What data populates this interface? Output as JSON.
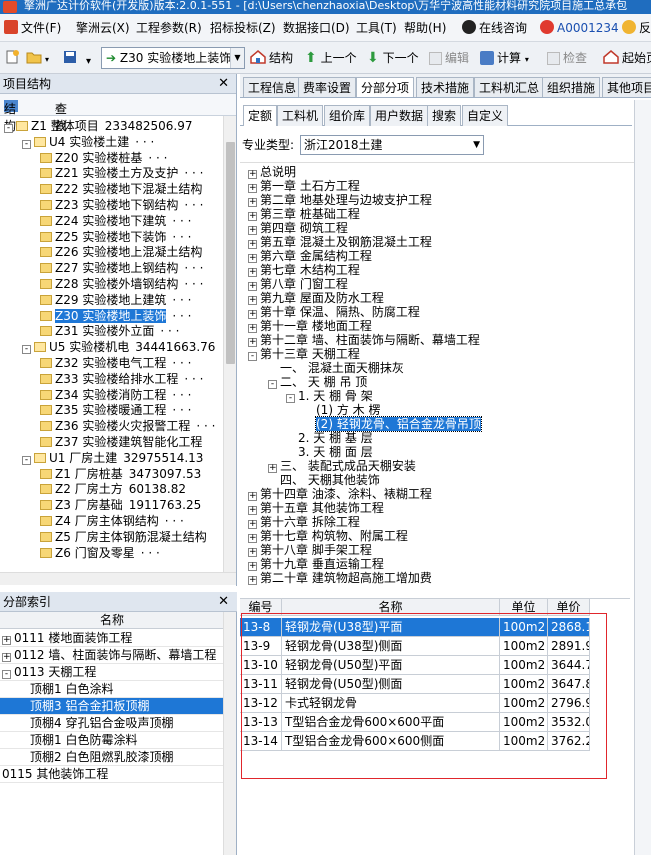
{
  "window": {
    "title": "擎洲广达计价软件(开发版)版本:2.0.1-551 - [d:\\Users\\chenzhaoxia\\Desktop\\万华宁波高性能材料研究院项目施工总承包"
  },
  "menu": {
    "items": [
      "文件(F)",
      "擎洲云(X)",
      "工程参数(R)",
      "招标投标(Z)",
      "数据接口(D)",
      "工具(T)",
      "帮助(H)"
    ],
    "online": "在线咨询",
    "user": "A0001234",
    "extra": "反"
  },
  "toolbar": {
    "current_node": "Z30 实验楼地上装饰",
    "structure": "结构",
    "prev": "上一个",
    "next": "下一个",
    "edit": "编辑",
    "calc": "计算",
    "check": "检查",
    "start": "起始页"
  },
  "project_panel": {
    "title": "项目结构",
    "tool_structure": "结构",
    "tool_find": "查找",
    "tree": [
      {
        "code": "Z1",
        "name": "整体项目",
        "value": "233482506.97",
        "level": 0,
        "expander": "-"
      },
      {
        "code": "U4",
        "name": "实验楼土建",
        "value": "· · ·",
        "level": 1,
        "expander": "-"
      },
      {
        "code": "Z20",
        "name": "实验楼桩基",
        "value": "· · ·",
        "level": 2
      },
      {
        "code": "Z21",
        "name": "实验楼土方及支护",
        "value": "· · ·",
        "level": 2
      },
      {
        "code": "Z22",
        "name": "实验楼地下混凝土结构",
        "value": "",
        "level": 2
      },
      {
        "code": "Z23",
        "name": "实验楼地下钢结构",
        "value": "· · ·",
        "level": 2
      },
      {
        "code": "Z24",
        "name": "实验楼地下建筑",
        "value": "· · ·",
        "level": 2
      },
      {
        "code": "Z25",
        "name": "实验楼地下装饰",
        "value": "· · ·",
        "level": 2
      },
      {
        "code": "Z26",
        "name": "实验楼地上混凝土结构",
        "value": "",
        "level": 2
      },
      {
        "code": "Z27",
        "name": "实验楼地上钢结构",
        "value": "· · ·",
        "level": 2
      },
      {
        "code": "Z28",
        "name": "实验楼外墙钢结构",
        "value": "· · ·",
        "level": 2
      },
      {
        "code": "Z29",
        "name": "实验楼地上建筑",
        "value": "· · ·",
        "level": 2
      },
      {
        "code": "Z30",
        "name": "实验楼地上装饰",
        "value": "· · ·",
        "level": 2,
        "selected": true
      },
      {
        "code": "Z31",
        "name": "实验楼外立面",
        "value": "· · ·",
        "level": 2
      },
      {
        "code": "U5",
        "name": "实验楼机电",
        "value": "34441663.76",
        "level": 1,
        "expander": "-"
      },
      {
        "code": "Z32",
        "name": "实验楼电气工程",
        "value": "· · ·",
        "level": 2
      },
      {
        "code": "Z33",
        "name": "实验楼给排水工程",
        "value": "· · ·",
        "level": 2
      },
      {
        "code": "Z34",
        "name": "实验楼消防工程",
        "value": "· · ·",
        "level": 2
      },
      {
        "code": "Z35",
        "name": "实验楼暖通工程",
        "value": "· · ·",
        "level": 2
      },
      {
        "code": "Z36",
        "name": "实验楼火灾报警工程",
        "value": "· · ·",
        "level": 2
      },
      {
        "code": "Z37",
        "name": "实验楼建筑智能化工程",
        "value": "",
        "level": 2
      },
      {
        "code": "U1",
        "name": "厂房土建",
        "value": "32975514.13",
        "level": 1,
        "expander": "-"
      },
      {
        "code": "Z1",
        "name": "厂房桩基",
        "value": "3473097.53",
        "level": 2
      },
      {
        "code": "Z2",
        "name": "厂房土方",
        "value": "60138.82",
        "level": 2
      },
      {
        "code": "Z3",
        "name": "厂房基础",
        "value": "1911763.25",
        "level": 2
      },
      {
        "code": "Z4",
        "name": "厂房主体钢结构",
        "value": "· · ·",
        "level": 2
      },
      {
        "code": "Z5",
        "name": "厂房主体钢筋混凝土结构",
        "value": "",
        "level": 2
      },
      {
        "code": "Z6",
        "name": "门窗及零星",
        "value": "· · ·",
        "level": 2
      }
    ]
  },
  "index_panel": {
    "title": "分部索引",
    "header": "名称",
    "rows": [
      {
        "text": "0111 楼地面装饰工程",
        "level": 0,
        "expander": "+"
      },
      {
        "text": "0112 墙、柱面装饰与隔断、幕墙工程",
        "level": 0,
        "expander": "+"
      },
      {
        "text": "0113 天棚工程",
        "level": 0,
        "expander": "-"
      },
      {
        "text": "顶棚1 白色涂料",
        "level": 1
      },
      {
        "text": "顶棚3 铝合金扣板顶棚",
        "level": 1,
        "selected": true
      },
      {
        "text": "顶棚4 穿孔铝合金吸声顶棚",
        "level": 1
      },
      {
        "text": "顶棚1 白色防霉涂料",
        "level": 1
      },
      {
        "text": "顶棚2 白色阻燃乳胶漆顶棚",
        "level": 1
      },
      {
        "text": "0115 其他装饰工程",
        "level": 0
      }
    ]
  },
  "main_tabs": [
    "工程信息",
    "费率设置",
    "分部分项",
    "技术措施",
    "工料机汇总",
    "组织措施",
    "其他项目"
  ],
  "main_tabs_active": 2,
  "sub_tabs": [
    "定额",
    "工料机",
    "组价库",
    "用户数据",
    "搜索",
    "自定义"
  ],
  "sub_tabs_active": 0,
  "spec_label": "专业类型:",
  "spec_value": "浙江2018土建",
  "chapters": [
    {
      "text": "总说明",
      "level": 0,
      "expander": "+"
    },
    {
      "text": "第一章 土石方工程",
      "level": 0,
      "expander": "+"
    },
    {
      "text": "第二章 地基处理与边坡支护工程",
      "level": 0,
      "expander": "+"
    },
    {
      "text": "第三章 桩基础工程",
      "level": 0,
      "expander": "+"
    },
    {
      "text": "第四章 砌筑工程",
      "level": 0,
      "expander": "+"
    },
    {
      "text": "第五章 混凝土及钢筋混凝土工程",
      "level": 0,
      "expander": "+"
    },
    {
      "text": "第六章 金属结构工程",
      "level": 0,
      "expander": "+"
    },
    {
      "text": "第七章 木结构工程",
      "level": 0,
      "expander": "+"
    },
    {
      "text": "第八章 门窗工程",
      "level": 0,
      "expander": "+"
    },
    {
      "text": "第九章 屋面及防水工程",
      "level": 0,
      "expander": "+"
    },
    {
      "text": "第十章 保温、隔热、防腐工程",
      "level": 0,
      "expander": "+"
    },
    {
      "text": "第十一章 楼地面工程",
      "level": 0,
      "expander": "+"
    },
    {
      "text": "第十二章 墙、柱面装饰与隔断、幕墙工程",
      "level": 0,
      "expander": "+"
    },
    {
      "text": "第十三章 天棚工程",
      "level": 0,
      "expander": "-"
    },
    {
      "text": "一、  混凝土面天棚抹灰",
      "level": 1
    },
    {
      "text": "二、  天 棚 吊 顶",
      "level": 1,
      "expander": "-"
    },
    {
      "text": "1.  天 棚 骨 架",
      "level": 2,
      "expander": "-"
    },
    {
      "text": "(1)  方  木  楞",
      "level": 3
    },
    {
      "text": "(2)  轻钢龙骨、铝合金龙骨吊顶",
      "level": 3,
      "selected": true
    },
    {
      "text": "2.  天 棚 基 层",
      "level": 2
    },
    {
      "text": "3.  天 棚 面 层",
      "level": 2
    },
    {
      "text": "三、  装配式成品天棚安装",
      "level": 1,
      "expander": "+"
    },
    {
      "text": "四、  天棚其他装饰",
      "level": 1
    },
    {
      "text": "第十四章 油漆、涂料、裱糊工程",
      "level": 0,
      "expander": "+"
    },
    {
      "text": "第十五章 其他装饰工程",
      "level": 0,
      "expander": "+"
    },
    {
      "text": "第十六章 拆除工程",
      "level": 0,
      "expander": "+"
    },
    {
      "text": "第十七章 构筑物、附属工程",
      "level": 0,
      "expander": "+"
    },
    {
      "text": "第十八章 脚手架工程",
      "level": 0,
      "expander": "+"
    },
    {
      "text": "第十九章 垂直运输工程",
      "level": 0,
      "expander": "+"
    },
    {
      "text": "第二十章 建筑物超高施工增加费",
      "level": 0,
      "expander": "+"
    }
  ],
  "quota_table": {
    "headers": [
      "编号",
      "名称",
      "单位",
      "单价"
    ],
    "rows": [
      {
        "code": "13-8",
        "name": "轻钢龙骨(U38型)平面",
        "unit": "100m2",
        "price": "2868.1",
        "selected": true
      },
      {
        "code": "13-9",
        "name": "轻钢龙骨(U38型)侧面",
        "unit": "100m2",
        "price": "2891.9"
      },
      {
        "code": "13-10",
        "name": "轻钢龙骨(U50型)平面",
        "unit": "100m2",
        "price": "3644.7"
      },
      {
        "code": "13-11",
        "name": "轻钢龙骨(U50型)侧面",
        "unit": "100m2",
        "price": "3647.8"
      },
      {
        "code": "13-12",
        "name": "卡式轻钢龙骨",
        "unit": "100m2",
        "price": "2796.9"
      },
      {
        "code": "13-13",
        "name": "T型铝合金龙骨600×600平面",
        "unit": "100m2",
        "price": "3532.0"
      },
      {
        "code": "13-14",
        "name": "T型铝合金龙骨600×600侧面",
        "unit": "100m2",
        "price": "3762.2"
      }
    ]
  },
  "colors": {
    "selection": "#1e77d6",
    "highlight_box": "#e0262c",
    "titlebar": "#1f6dbf"
  }
}
